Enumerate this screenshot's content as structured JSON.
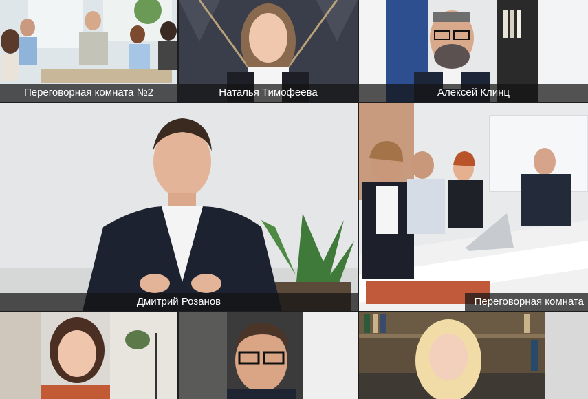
{
  "app": {
    "layout": "video-conference-gallery"
  },
  "participants": [
    {
      "name": "Переговорная комната №2",
      "type": "room"
    },
    {
      "name": "Наталья Тимофеева",
      "type": "person"
    },
    {
      "name": "Алексей Клинц",
      "type": "person"
    },
    {
      "name": "Дмитрий Розанов",
      "type": "person",
      "active_speaker": true
    },
    {
      "name": "Переговорная комната",
      "type": "room"
    },
    {
      "name": "",
      "type": "person"
    },
    {
      "name": "",
      "type": "person"
    },
    {
      "name": "",
      "type": "person"
    }
  ],
  "colors": {
    "label_bg": "#141414",
    "label_text": "#ffffff",
    "gap": "#1e1e1e"
  }
}
